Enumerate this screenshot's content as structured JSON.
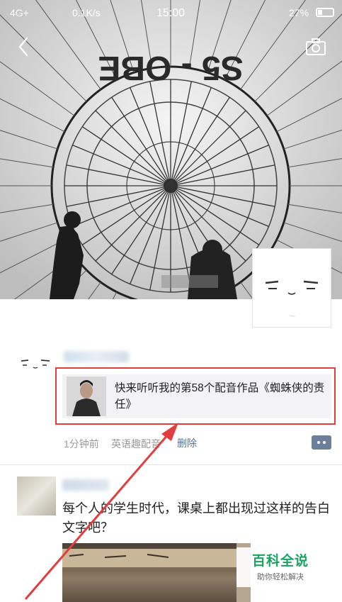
{
  "status_bar": {
    "network": "4G+",
    "speed": "0.1K/s",
    "time": "15:00",
    "battery": "27%"
  },
  "header": {
    "back_icon": "chevron-left-icon",
    "camera_icon": "camera-icon",
    "cover_text": "S5 - OBE"
  },
  "post1": {
    "share_title": "快来听听我的第58个配音作品《蜘蛛侠的责任》",
    "time": "1分钟前",
    "source": "英语趣配音",
    "delete_label": "删除"
  },
  "post2": {
    "text": "每个人的学生时代，课桌上都出现过这样的告白文字吧？"
  },
  "watermark": {
    "main": "百科全说",
    "sub": "助你轻松解决"
  },
  "colors": {
    "highlight": "#e03d3d",
    "link": "#55749a",
    "watermark": "#1aa260"
  }
}
